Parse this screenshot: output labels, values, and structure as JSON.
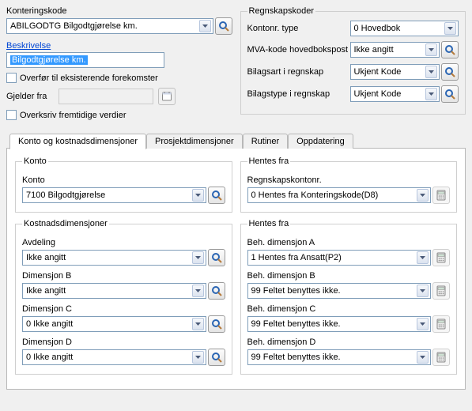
{
  "left": {
    "konteringskode_label": "Konteringskode",
    "konteringskode_value": "ABILGODTG Bilgodtgjørelse km.",
    "beskrivelse_label": "Beskrivelse",
    "beskrivelse_value": "Bilgodtgjørelse km.",
    "overfor_label": "Overfør til eksisterende forekomster",
    "gjelder_fra_label": "Gjelder fra",
    "overskriv_label": "Overksriv fremtidige verdier"
  },
  "right": {
    "group_label": "Regnskapskoder",
    "kontonr_type_label": "Kontonr. type",
    "kontonr_type_value": "0 Hovedbok",
    "mva_label": "MVA-kode hovedbokspost",
    "mva_value": "Ikke angitt",
    "bilagsart_label": "Bilagsart i regnskap",
    "bilagsart_value": "Ukjent Kode",
    "bilagstype_label": "Bilagstype i regnskap",
    "bilagstype_value": "Ukjent Kode"
  },
  "tabs": {
    "t1": "Konto og kostnadsdimensjoner",
    "t2": "Prosjektdimensjoner",
    "t3": "Rutiner",
    "t4": "Oppdatering"
  },
  "konto": {
    "group_label": "Konto",
    "konto_label": "Konto",
    "konto_value": "7100 Bilgodtgjørelse"
  },
  "hentes_top": {
    "group_label": "Hentes fra",
    "regnskapskontonr_label": "Regnskapskontonr.",
    "regnskapskontonr_value": "0 Hentes fra Konteringskode(D8)"
  },
  "kostnad": {
    "group_label": "Kostnadsdimensjoner",
    "avdeling_label": "Avdeling",
    "avdeling_value": "Ikke angitt",
    "dimb_label": "Dimensjon B",
    "dimb_value": "Ikke angitt",
    "dimc_label": "Dimensjon C",
    "dimc_value": "0 Ikke angitt",
    "dimd_label": "Dimensjon D",
    "dimd_value": "0 Ikke angitt"
  },
  "hentes_bottom": {
    "group_label": "Hentes fra",
    "beha_label": "Beh. dimensjon A",
    "beha_value": "1 Hentes fra Ansatt(P2)",
    "behb_label": "Beh. dimensjon B",
    "behb_value": "99 Feltet benyttes ikke.",
    "behc_label": "Beh. dimensjon C",
    "behc_value": "99 Feltet benyttes ikke.",
    "behd_label": "Beh. dimensjon D",
    "behd_value": "99 Feltet benyttes ikke."
  }
}
